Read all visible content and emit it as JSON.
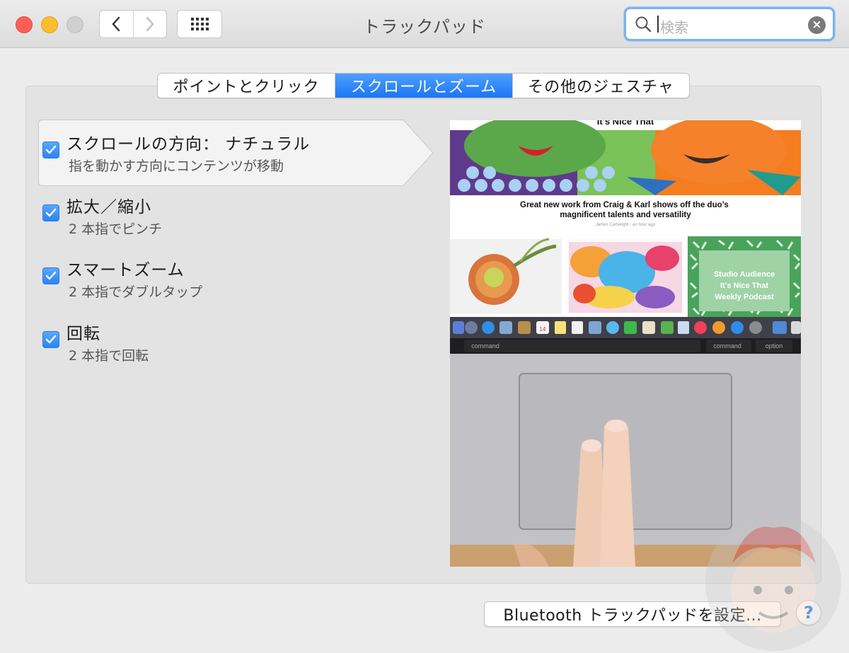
{
  "window": {
    "title": "トラックパッド",
    "search_placeholder": "検索"
  },
  "tabs": [
    {
      "label": "ポイントとクリック",
      "selected": false
    },
    {
      "label": "スクロールとズーム",
      "selected": true
    },
    {
      "label": "その他のジェスチャ",
      "selected": false
    }
  ],
  "options": [
    {
      "title": "スクロールの方向： ナチュラル",
      "subtitle": "指を動かす方向にコンテンツが移動",
      "checked": true,
      "selected": true
    },
    {
      "title": "拡大／縮小",
      "subtitle": "2 本指でピンチ",
      "checked": true,
      "selected": false
    },
    {
      "title": "スマートズーム",
      "subtitle": "2 本指でダブルタップ",
      "checked": true,
      "selected": false
    },
    {
      "title": "回転",
      "subtitle": "2 本指で回転",
      "checked": true,
      "selected": false
    }
  ],
  "preview": {
    "site_header": "It's Nice That",
    "headline": "Great new work from Craig & Karl shows off the duo's magnificent talents and versatility",
    "byline": "James Cartwright · an hour ago",
    "podcast_lines": [
      "Studio Audience",
      "It's Nice That",
      "Weekly Podcast"
    ],
    "keys": [
      "command",
      "command",
      "option"
    ],
    "calendar_day": "14"
  },
  "bottom": {
    "bluetooth_button": "Bluetooth トラックパッドを設定...",
    "help_label": "?"
  },
  "colors": {
    "accent": "#2b84f5",
    "selected_tab": "#1b75f6",
    "close": "#fc5f57",
    "minimize": "#fdbc2e"
  }
}
